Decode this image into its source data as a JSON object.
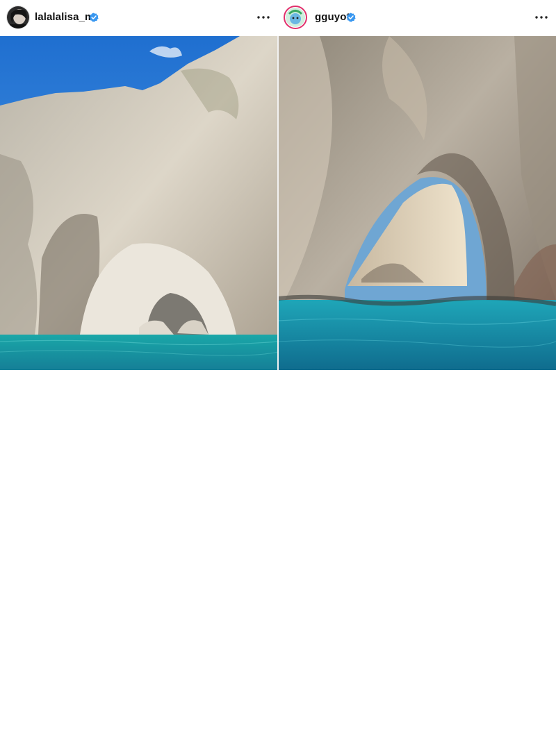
{
  "posts": [
    {
      "username": "lalalalisa_m",
      "verified": true,
      "more_label": "More options",
      "photo_description_icon": "sea-cliff-photo"
    },
    {
      "username": "gguyot",
      "verified": true,
      "more_label": "More options",
      "photo_description_icon": "sea-arch-photo"
    }
  ],
  "colors": {
    "verified_badge": "#3897f0",
    "sky": "#2f7fd8",
    "water": "#1fa9b6",
    "rock": "#cfc3b0"
  }
}
